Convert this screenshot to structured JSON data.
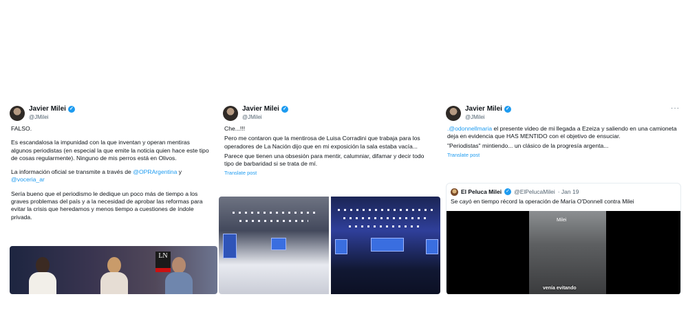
{
  "tweet1": {
    "name": "Javier Milei",
    "handle": "@JMilei",
    "p1": "FALSO.",
    "p2": "Es escandalosa la impunidad con la que inventan y operan mentiras algunos periodistas (en especial la que emite la noticia quien hace este tipo de cosas regularmente). Ninguno de mis perros está en Olivos.",
    "p3_text": "La información oficial se transmite a través de ",
    "p3_link1": "@OPRArgentina",
    "p3_and": " y ",
    "p3_link2": "@voceria_ar",
    "p4": "Sería bueno que el periodismo le dedique un poco más de tiempo a los graves problemas del país y a la necesidad de aprobar las reformas para evitar la crisis que heredamos y menos tiempo a cuestiones de índole privada.",
    "tv_logo": "LN"
  },
  "tweet2": {
    "name": "Javier Milei",
    "handle": "@JMilei",
    "p1": "Che...!!!",
    "p2": "Pero me contaron que la mentirosa de Luisa Corradini que trabaja para los operadores de La Nación dijo que en mi exposición la sala estaba vacía...",
    "p3": "Parece que tienen una obsesión para mentir, calumniar, difamar y decir todo tipo de barbaridad si se trata de mí.",
    "translate": "Translate post"
  },
  "tweet3": {
    "name": "Javier Milei",
    "handle": "@JMilei",
    "more": "···",
    "p1_link": ".@odonnellmaria",
    "p1_text": " el presente video de mi llegada a Ezeiza y saliendo en una camioneta deja en evidencia que HAS MENTIDO con el objetivo de ensuciar.",
    "p2": "\"Periodistas\" mintiendo... un clásico de la progresía argenta...",
    "translate": "Translate post",
    "quote": {
      "name": "El Peluca Milei",
      "handle": "@ElPelucaMilei",
      "date": "· Jan 19",
      "text": "Se cayó en tiempo récord la operación de María O'Donnell contra Milei",
      "video_caption": "venía evitando",
      "watermark": "Milei"
    }
  }
}
